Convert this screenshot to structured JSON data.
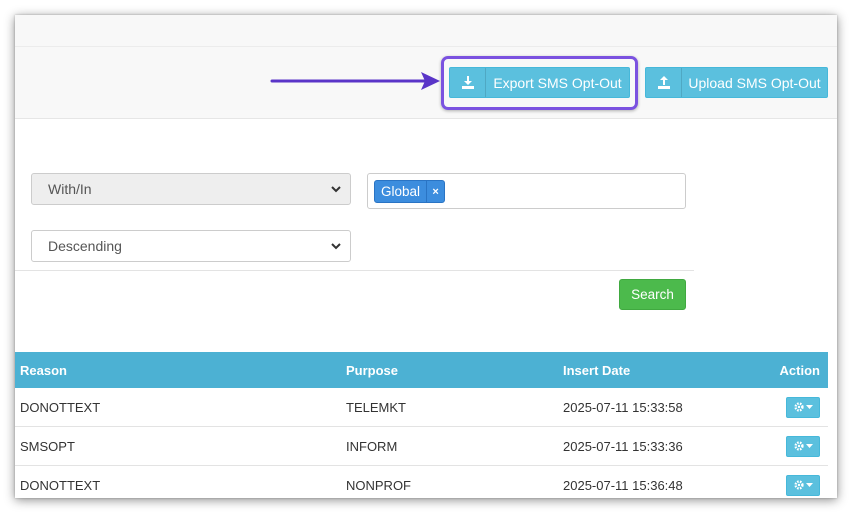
{
  "toolbar": {
    "export_label": "Export SMS Opt-Out",
    "export_icon": "download-icon",
    "upload_label": "Upload SMS Opt-Out",
    "upload_icon": "upload-icon"
  },
  "filters": {
    "match_type": "With/In",
    "sort_order": "Descending",
    "tags": [
      "Global"
    ],
    "search_label": "Search"
  },
  "table": {
    "headers": {
      "reason": "Reason",
      "purpose": "Purpose",
      "insert_date": "Insert Date",
      "action": "Action"
    },
    "rows": [
      {
        "reason": "DONOTTEXT",
        "purpose": "TELEMKT",
        "insert_date": "2025-07-11 15:33:58"
      },
      {
        "reason": "SMSOPT",
        "purpose": "INFORM",
        "insert_date": "2025-07-11 15:33:36"
      },
      {
        "reason": "DONOTTEXT",
        "purpose": "NONPROF",
        "insert_date": "2025-07-11 15:36:48"
      }
    ],
    "action_icon": "gear-icon"
  },
  "colors": {
    "info": "#5bc0de",
    "header": "#4cb1d3",
    "success": "#4cba4c",
    "tag": "#3c8dde",
    "highlight": "#7b52e0"
  }
}
